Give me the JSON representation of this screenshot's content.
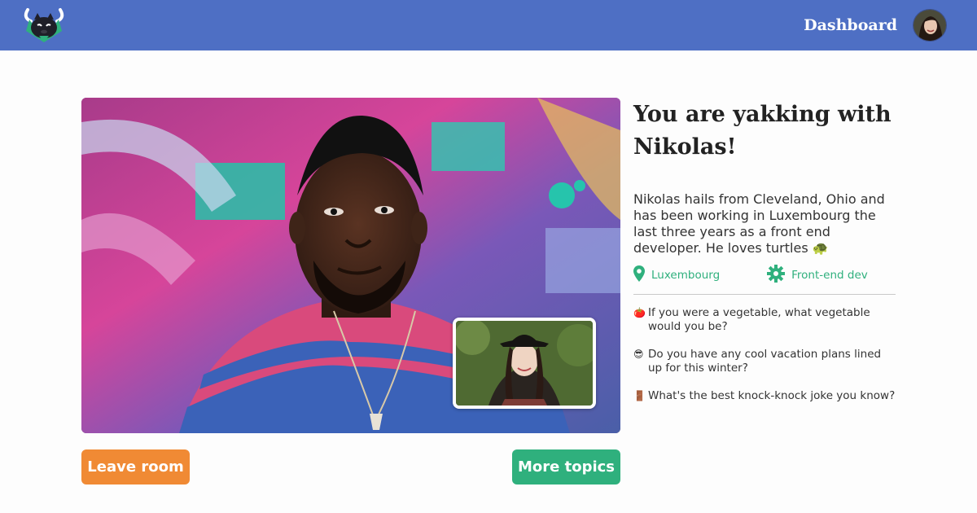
{
  "header": {
    "nav_label": "Dashboard",
    "logo_icon": "yak-logo-icon",
    "bg_color": "#4e6fc4"
  },
  "chat": {
    "headline": "You are yakking with Nikolas!",
    "bio": "Nikolas hails from Cleveland, Ohio and has been working in Luxembourg the last three years as a front end developer.  He loves turtles 🐢",
    "location": "Luxembourg",
    "location_icon": "map-pin-icon",
    "role": "Front-end dev",
    "role_icon": "gear-icon",
    "topics": [
      {
        "emoji": "🍅",
        "text": "If you were a vegetable, what vegetable would you be?"
      },
      {
        "emoji": "😎",
        "text": "Do you have any cool vacation plans lined up for this winter?"
      },
      {
        "emoji": "🚪",
        "text": "What's the best knock-knock joke you know?"
      }
    ]
  },
  "actions": {
    "leave_label": "Leave room",
    "more_label": "More topics",
    "leave_color": "#f08a34",
    "more_color": "#2fb07d"
  },
  "accent_color": "#2fb07d"
}
